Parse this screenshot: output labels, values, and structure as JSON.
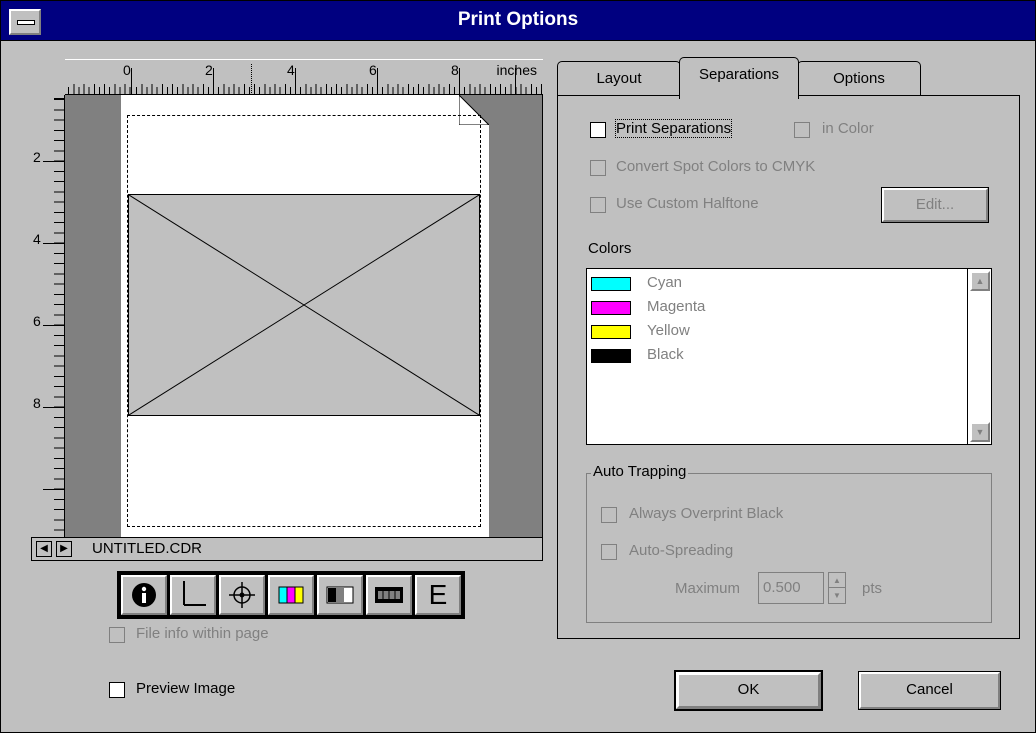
{
  "window": {
    "title": "Print Options"
  },
  "ruler": {
    "unit": "inches",
    "h_numbers": [
      "0",
      "2",
      "4",
      "6",
      "8"
    ],
    "v_numbers": [
      "2",
      "4",
      "6",
      "8"
    ]
  },
  "status": {
    "filename": "UNTITLED.CDR"
  },
  "tools": [
    "info-icon",
    "crop-marks-icon",
    "registration-marks-icon",
    "color-calibration-bar-icon",
    "densitometer-scale-icon",
    "film-negative-icon",
    "emulsion-icon"
  ],
  "left": {
    "file_info_label": "File info within page",
    "preview_label": "Preview Image",
    "tool_e_label": "E"
  },
  "tabs": [
    {
      "label": "Layout",
      "active": false
    },
    {
      "label": "Separations",
      "active": true
    },
    {
      "label": "Options",
      "active": false
    }
  ],
  "separations": {
    "print_separations": "Print Separations",
    "in_color": "in Color",
    "convert_spot": "Convert Spot Colors to CMYK",
    "custom_halftone": "Use Custom Halftone",
    "edit_button": "Edit...",
    "colors_label": "Colors",
    "colors": [
      {
        "name": "Cyan",
        "hex": "#00ffff"
      },
      {
        "name": "Magenta",
        "hex": "#ff00ff"
      },
      {
        "name": "Yellow",
        "hex": "#ffff00"
      },
      {
        "name": "Black",
        "hex": "#000000"
      }
    ],
    "auto_trapping": {
      "title": "Auto Trapping",
      "always_overprint": "Always Overprint Black",
      "auto_spreading": "Auto-Spreading",
      "maximum_label": "Maximum",
      "maximum_value": "0.500",
      "unit": "pts"
    }
  },
  "buttons": {
    "ok": "OK",
    "cancel": "Cancel"
  },
  "colors": {
    "titlebar": "#000080",
    "face": "#c0c0c0",
    "disabled_text": "#808080"
  }
}
